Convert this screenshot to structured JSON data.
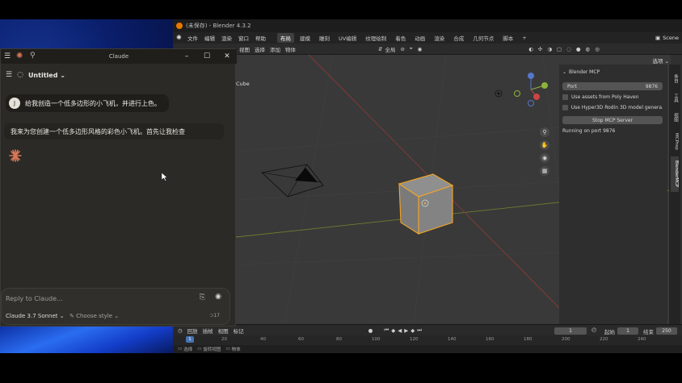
{
  "blender": {
    "window_title": "(未保存) - Blender 4.3.2",
    "menus": [
      "文件",
      "编辑",
      "渲染",
      "窗口",
      "帮助"
    ],
    "workspaces": [
      "布局",
      "建模",
      "雕刻",
      "UV编辑",
      "纹理绘制",
      "着色",
      "动画",
      "渲染",
      "合成",
      "几何节点",
      "脚本"
    ],
    "active_workspace": "布局",
    "scene_name": "Scene",
    "header_items": [
      "视图",
      "选择",
      "添加",
      "物体"
    ],
    "transform_orientation": "全局",
    "options_label": "选项",
    "viewport_object_label": "Cube",
    "npanel": {
      "title": "Blender MCP",
      "port_label": "Port",
      "port_value": "9876",
      "poly_haven_label": "Use assets from Poly Haven",
      "hyper3d_label": "Use Hyper3D Rodin 3D model genera...",
      "stop_button": "Stop MCP Server",
      "status": "Running on port 9876"
    },
    "side_tabs": [
      "条目",
      "工具",
      "视图",
      "MCPrep",
      "BlenderMCP"
    ],
    "active_side_tab": "BlenderMCP",
    "timeline": {
      "header_items": [
        "回放",
        "插帧",
        "视图",
        "标记"
      ],
      "current_frame": "1",
      "start_label": "起始",
      "start_value": "1",
      "end_label": "结束",
      "end_value": "250",
      "ruler_ticks": [
        "1",
        "20",
        "40",
        "60",
        "80",
        "100",
        "120",
        "140",
        "160",
        "180",
        "200",
        "220",
        "240"
      ],
      "indicator": "1"
    },
    "status_items": [
      "选择",
      "旋转视图",
      "物体"
    ]
  },
  "claude": {
    "window_title": "Claude",
    "conversation_title": "Untitled",
    "user_avatar": "J",
    "user_message": "给我创造一个低多边形的小飞机，并进行上色。",
    "assistant_message": "我来为您创建一个低多边形风格的彩色小飞机。首先让我检查",
    "composer_placeholder": "Reply to Claude...",
    "model": "Claude 3.7 Sonnet",
    "style_label": "Choose style",
    "token_count": "17"
  },
  "colors": {
    "blender_accent": "#ea7600",
    "selected_outline": "#f5a623",
    "claude_accent": "#d97757"
  }
}
